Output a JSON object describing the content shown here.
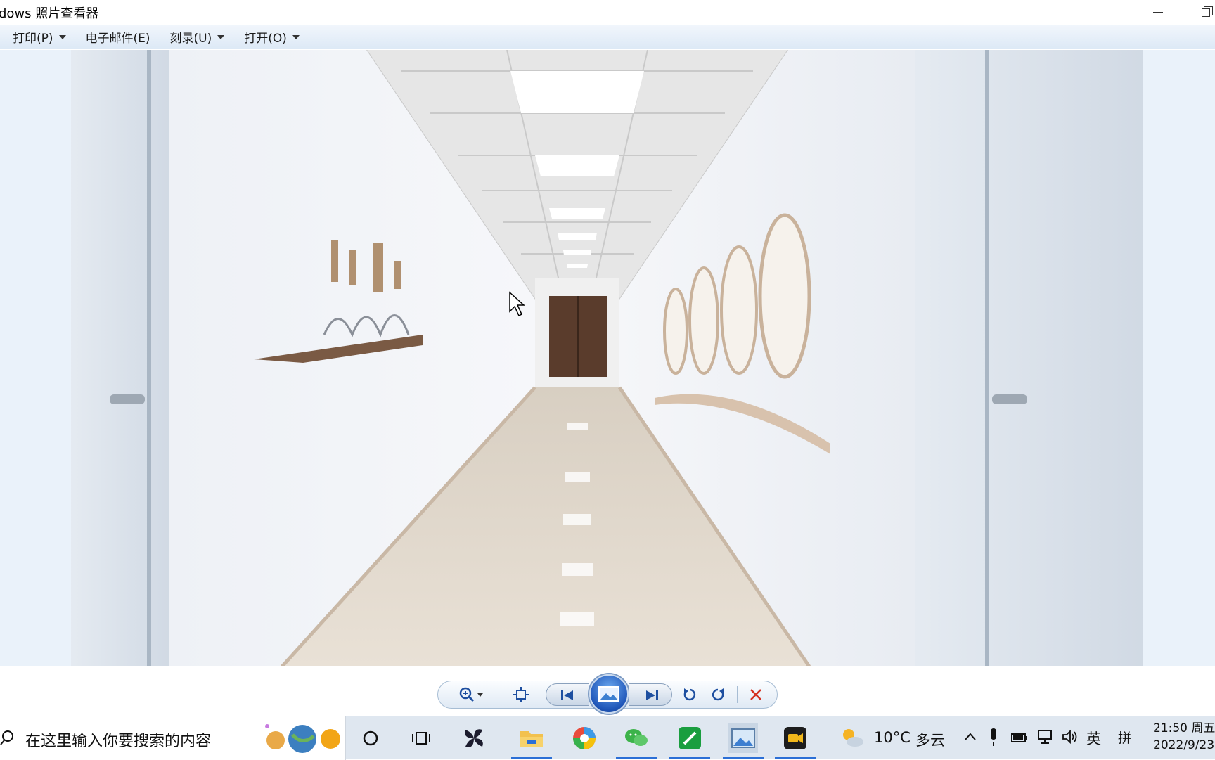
{
  "window": {
    "title": "dows 照片查看器"
  },
  "menu": {
    "items": [
      {
        "label": "打印(P)",
        "has_dropdown": true
      },
      {
        "label": "电子邮件(E)",
        "has_dropdown": false
      },
      {
        "label": "刻录(U)",
        "has_dropdown": true
      },
      {
        "label": "打开(O)",
        "has_dropdown": true
      }
    ]
  },
  "controls": {
    "icons": [
      "zoom-icon",
      "fit-window-icon",
      "previous-icon",
      "slideshow-icon",
      "next-icon",
      "rotate-counterclockwise-icon",
      "rotate-clockwise-icon",
      "delete-icon"
    ]
  },
  "taskbar": {
    "search_placeholder": "在这里输入你要搜索的内容",
    "apps": [
      "cortana-icon",
      "task-view-icon",
      "pinwheel-app-icon",
      "file-explorer-icon",
      "browser-icon",
      "wechat-icon",
      "green-app-icon",
      "photo-viewer-icon",
      "video-recorder-icon"
    ],
    "weather_temp": "10°C",
    "weather_desc": "多云",
    "ime_lang": "英",
    "ime_mode": "拼",
    "time": "21:50 周五",
    "date": "2022/9/23"
  },
  "colors": {
    "menubar": "#dde9f6",
    "viewer_bg": "#eaf2fa",
    "taskbar": "#dfe7f0",
    "accent": "#2b6fd6",
    "delete": "#d4301f"
  }
}
